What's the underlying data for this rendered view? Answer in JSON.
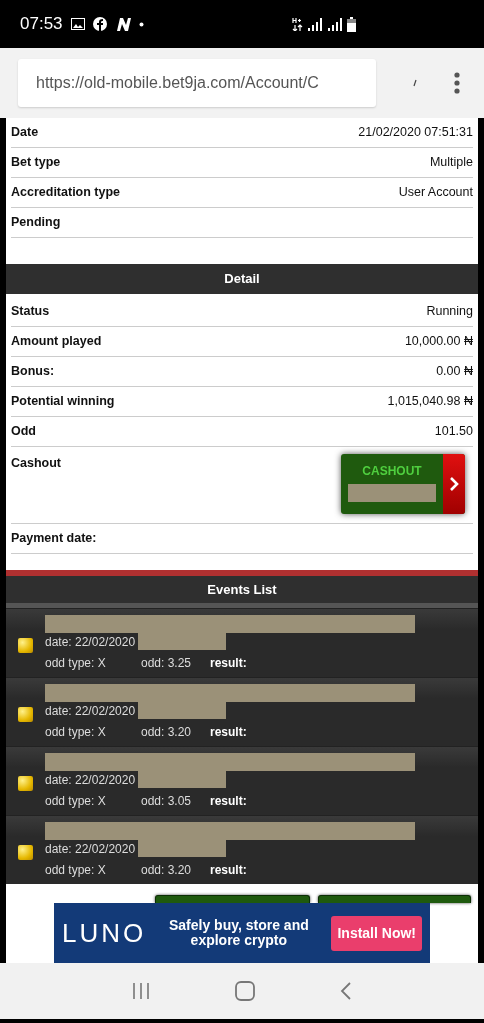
{
  "status_bar": {
    "time": "07:53"
  },
  "browser": {
    "url": "https://old-mobile.bet9ja.com/Account/C"
  },
  "summary": [
    {
      "label": "Date",
      "value": "21/02/2020 07:51:31"
    },
    {
      "label": "Bet type",
      "value": "Multiple"
    },
    {
      "label": "Accreditation type",
      "value": "User Account"
    },
    {
      "label": "Pending"
    }
  ],
  "detail": {
    "title": "Detail",
    "rows": [
      {
        "kind": "text",
        "label": "Status",
        "value": "Running"
      },
      {
        "kind": "text",
        "label": "Amount played",
        "value": "10,000.00 ₦"
      },
      {
        "kind": "text",
        "label": "Bonus:",
        "value": "0.00 ₦"
      },
      {
        "kind": "text",
        "label": "Potential winning",
        "value": "1,015,040.98 ₦"
      },
      {
        "kind": "text",
        "label": "Odd",
        "value": "101.50"
      },
      {
        "kind": "cashout",
        "label": "Cashout",
        "button": "CASHOUT"
      },
      {
        "kind": "text",
        "label": "Payment date:"
      }
    ]
  },
  "events": {
    "title": "Events List",
    "items": [
      {
        "date": "date: 22/02/2020",
        "odd_type": "odd type: X",
        "odd": "odd: 3.25",
        "result": "result:"
      },
      {
        "date": "date: 22/02/2020",
        "odd_type": "odd type: X",
        "odd": "odd: 3.20",
        "result": "result:"
      },
      {
        "date": "date: 22/02/2020",
        "odd_type": "odd type: X",
        "odd": "odd: 3.05",
        "result": "result:"
      },
      {
        "date": "date: 22/02/2020",
        "odd_type": "odd type: X",
        "odd": "odd: 3.20",
        "result": "result:"
      }
    ]
  },
  "ad": {
    "logo": "LUNO",
    "text": "Safely buy, store and explore crypto",
    "button": "Install Now!"
  }
}
